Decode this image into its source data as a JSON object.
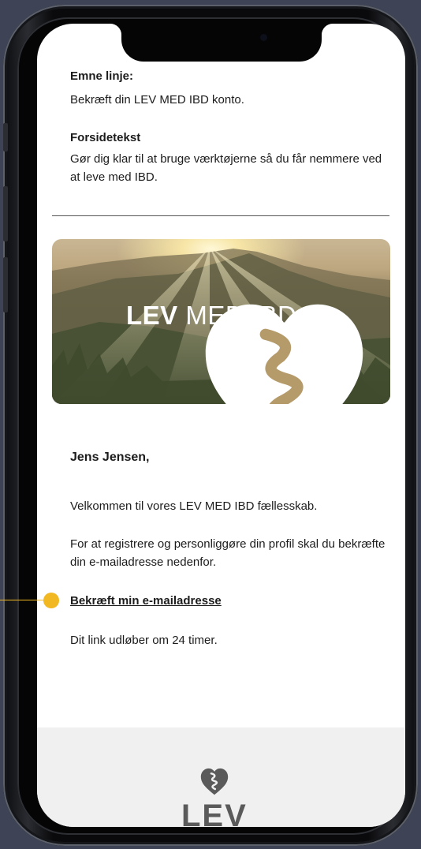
{
  "email": {
    "subject_label": "Emne linje:",
    "subject_text": "Bekræft din LEV MED IBD konto.",
    "front_label": "Forsidetekst",
    "front_text": "Gør dig klar til at bruge værktøjerne  så du får nemmere ved at leve med IBD.",
    "banner": {
      "brand_bold": "LEV",
      "brand_rest": " MED IBD"
    },
    "greeting": "Jens Jensen,",
    "welcome": "Velkommen til vores LEV MED IBD fællesskab.",
    "instruction": "For at registrere og personliggøre din profil skal du bekræfte din e-mailadresse nedenfor.",
    "confirm_link": "Bekræft min e-mailadresse",
    "expiry": "Dit link udløber om 24 timer.",
    "footer_brand": "LEV"
  },
  "colors": {
    "accent": "#f2b822",
    "background": "#3e4455",
    "footer_bg": "#f0f0f0",
    "heart": "#5a5a5a"
  },
  "icons": {
    "banner_logo": "heart-intestine-icon",
    "footer_logo": "heart-intestine-icon"
  }
}
